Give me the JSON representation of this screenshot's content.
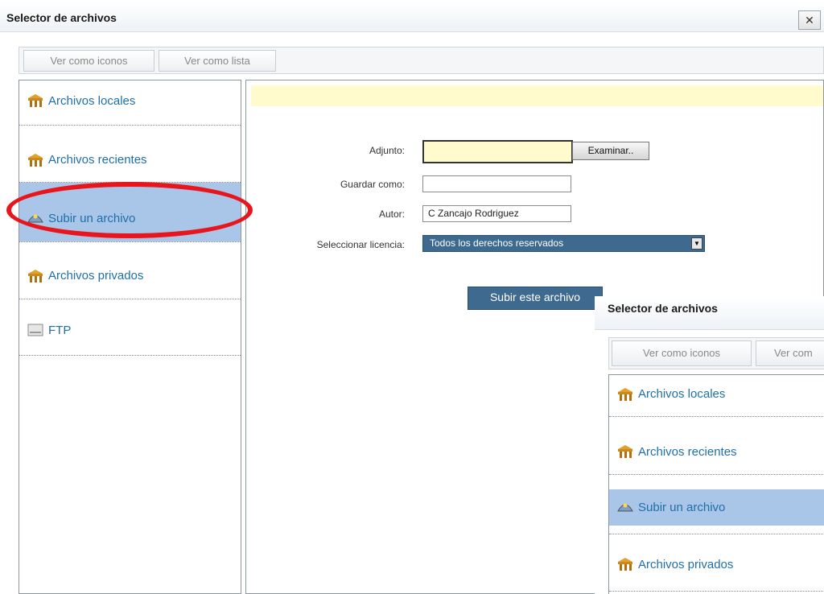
{
  "main_dialog": {
    "title": "Selector de archivos",
    "close_label": "✕",
    "view_buttons": [
      "Ver como iconos",
      "Ver como lista"
    ],
    "nav_items": [
      {
        "label": "Archivos locales",
        "icon": "repository-icon"
      },
      {
        "label": "Archivos recientes",
        "icon": "repository-icon"
      },
      {
        "label": "Subir un archivo",
        "icon": "upload-icon",
        "selected": true
      },
      {
        "label": "Archivos privados",
        "icon": "repository-icon"
      },
      {
        "label": "FTP",
        "icon": "ftp-icon"
      }
    ],
    "form": {
      "attachment_label": "Adjunto:",
      "browse_label": "Examinar..",
      "save_as_label": "Guardar como:",
      "save_as_value": "",
      "author_label": "Autor:",
      "author_value": "C Zancajo Rodriguez",
      "license_label": "Seleccionar licencia:",
      "license_value": "Todos los derechos reservados",
      "submit_label": "Subir este archivo"
    }
  },
  "overlay_dialog": {
    "title": "Selector de archivos",
    "view_buttons": [
      "Ver como iconos",
      "Ver com"
    ],
    "nav_items": [
      {
        "label": "Archivos locales",
        "icon": "repository-icon"
      },
      {
        "label": "Archivos recientes",
        "icon": "repository-icon"
      },
      {
        "label": "Subir un archivo",
        "icon": "upload-icon",
        "selected": true
      },
      {
        "label": "Archivos privados",
        "icon": "repository-icon"
      }
    ]
  },
  "colors": {
    "selected_bg": "#a9c6e8",
    "link": "#1f6fa8",
    "button_blue": "#3d6a8e",
    "notice_yellow": "#fffbcc",
    "highlight_red": "#e8151c"
  }
}
